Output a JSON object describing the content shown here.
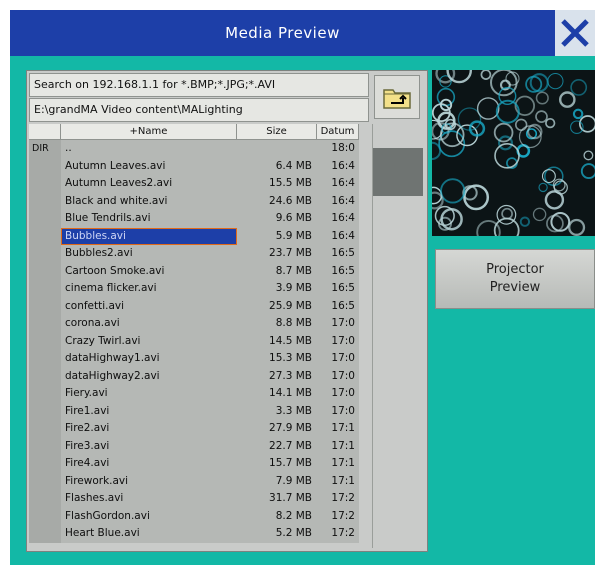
{
  "window": {
    "title": "Media Preview",
    "colors": {
      "background": "#13b8a6",
      "titlebar": "#1d3fa8",
      "selection": "#1d3fa8",
      "selection_outline": "#e06a1a"
    }
  },
  "browser": {
    "search_text": "Search on 192.168.1.1 for *.BMP;*.JPG;*.AVI",
    "path_text": "E:\\grandMA Video content\\MALighting",
    "folder_icon": "folder-up-icon",
    "columns": [
      "",
      "+Name",
      "Size",
      "Datum"
    ],
    "rows": [
      {
        "type": "DIR",
        "name": "..",
        "size": "",
        "date": "18:0",
        "selected": false
      },
      {
        "type": "",
        "name": "Autumn Leaves.avi",
        "size": "6.4 MB",
        "date": "16:4",
        "selected": false
      },
      {
        "type": "",
        "name": "Autumn Leaves2.avi",
        "size": "15.5 MB",
        "date": "16:4",
        "selected": false
      },
      {
        "type": "",
        "name": "Black and white.avi",
        "size": "24.6 MB",
        "date": "16:4",
        "selected": false
      },
      {
        "type": "",
        "name": "Blue Tendrils.avi",
        "size": "9.6 MB",
        "date": "16:4",
        "selected": false
      },
      {
        "type": "",
        "name": "Bubbles.avi",
        "size": "5.9 MB",
        "date": "16:4",
        "selected": true
      },
      {
        "type": "",
        "name": "Bubbles2.avi",
        "size": "23.7 MB",
        "date": "16:5",
        "selected": false
      },
      {
        "type": "",
        "name": "Cartoon Smoke.avi",
        "size": "8.7 MB",
        "date": "16:5",
        "selected": false
      },
      {
        "type": "",
        "name": "cinema flicker.avi",
        "size": "3.9 MB",
        "date": "16:5",
        "selected": false
      },
      {
        "type": "",
        "name": "confetti.avi",
        "size": "25.9 MB",
        "date": "16:5",
        "selected": false
      },
      {
        "type": "",
        "name": "corona.avi",
        "size": "8.8 MB",
        "date": "17:0",
        "selected": false
      },
      {
        "type": "",
        "name": "Crazy Twirl.avi",
        "size": "14.5 MB",
        "date": "17:0",
        "selected": false
      },
      {
        "type": "",
        "name": "dataHighway1.avi",
        "size": "15.3 MB",
        "date": "17:0",
        "selected": false
      },
      {
        "type": "",
        "name": "dataHighway2.avi",
        "size": "27.3 MB",
        "date": "17:0",
        "selected": false
      },
      {
        "type": "",
        "name": "Fiery.avi",
        "size": "14.1 MB",
        "date": "17:0",
        "selected": false
      },
      {
        "type": "",
        "name": "Fire1.avi",
        "size": "3.3 MB",
        "date": "17:0",
        "selected": false
      },
      {
        "type": "",
        "name": "Fire2.avi",
        "size": "27.9 MB",
        "date": "17:1",
        "selected": false
      },
      {
        "type": "",
        "name": "Fire3.avi",
        "size": "22.7 MB",
        "date": "17:1",
        "selected": false
      },
      {
        "type": "",
        "name": "Fire4.avi",
        "size": "15.7 MB",
        "date": "17:1",
        "selected": false
      },
      {
        "type": "",
        "name": "Firework.avi",
        "size": "7.9 MB",
        "date": "17:1",
        "selected": false
      },
      {
        "type": "",
        "name": "Flashes.avi",
        "size": "31.7 MB",
        "date": "17:2",
        "selected": false
      },
      {
        "type": "",
        "name": "FlashGordon.avi",
        "size": "8.2 MB",
        "date": "17:2",
        "selected": false
      },
      {
        "type": "",
        "name": "Heart Blue.avi",
        "size": "5.2 MB",
        "date": "17:2",
        "selected": false
      }
    ]
  },
  "preview": {
    "image": "bubbles-preview-image"
  },
  "projector_button": {
    "line1": "Projector",
    "line2": "Preview"
  },
  "close_icon": "close-icon"
}
